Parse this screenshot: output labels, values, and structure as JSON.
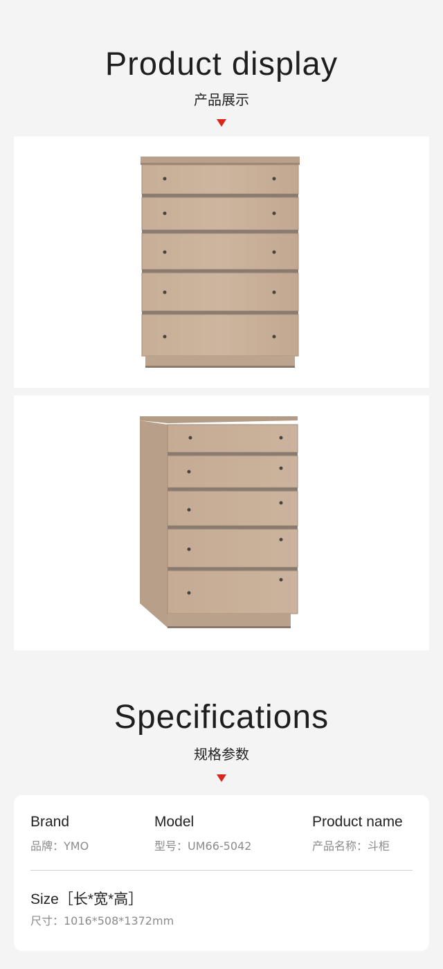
{
  "product_display": {
    "title": "Product display",
    "subtitle": "产品展示"
  },
  "images": [
    {
      "name": "chest-front-view"
    },
    {
      "name": "chest-angled-view"
    }
  ],
  "specifications": {
    "title": "Specifications",
    "subtitle": "规格参数",
    "brand": {
      "label": "Brand",
      "value": "品牌：YMO"
    },
    "model": {
      "label": "Model",
      "value": "型号：UM66-5042"
    },
    "product_name": {
      "label": "Product name",
      "value": "产品名称：斗柜"
    },
    "size": {
      "label": "Size［长*宽*高］",
      "value": "尺寸：1016*508*1372mm"
    }
  },
  "colors": {
    "accent": "#d7261b",
    "wood": "#c9b09a",
    "background": "#f4f4f4"
  }
}
